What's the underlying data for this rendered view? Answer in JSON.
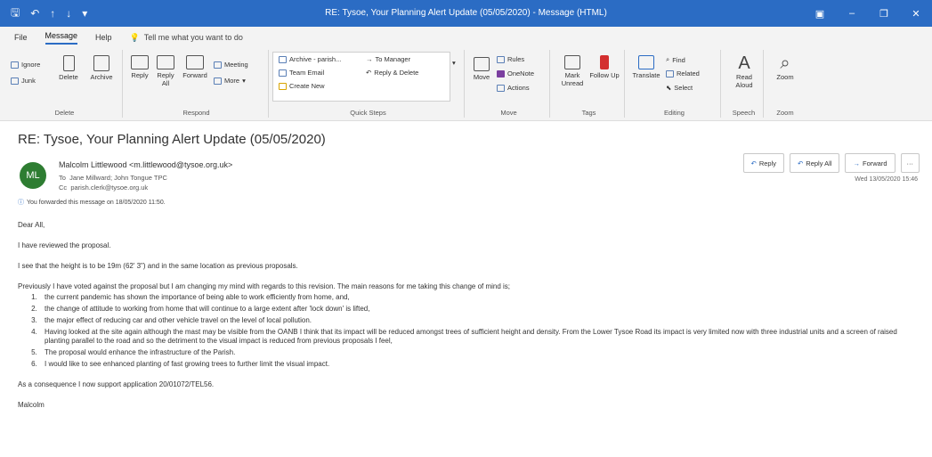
{
  "window": {
    "title": "RE: Tysoe, Your Planning Alert Update (05/05/2020) - Message (HTML)",
    "controls": {
      "ribbon_display": "▣",
      "minimize": "–",
      "maximize": "❐",
      "close": "✕"
    }
  },
  "quick_access": {
    "save_icon": "save-icon",
    "undo_icon": "undo-icon",
    "up_icon": "up-arrow-icon",
    "down_icon": "down-arrow-icon",
    "more_icon": "customize-icon"
  },
  "tabs": [
    "File",
    "Message",
    "Help"
  ],
  "active_tab": "Message",
  "tell_me": "Tell me what you want to do",
  "ribbon": {
    "delete_group": {
      "label": "Delete",
      "ignore": "Ignore",
      "junk": "Junk",
      "delete": "Delete",
      "archive": "Archive"
    },
    "respond_group": {
      "label": "Respond",
      "reply": "Reply",
      "reply_all": "Reply All",
      "forward": "Forward",
      "meeting": "Meeting",
      "more": "More"
    },
    "quick_steps": {
      "label": "Quick Steps",
      "items": [
        "Archive - parish...",
        "Team Email",
        "Create New",
        "To Manager",
        "Reply & Delete"
      ]
    },
    "move_group": {
      "label": "Move",
      "move": "Move",
      "rules": "Rules",
      "onenote": "OneNote",
      "actions": "Actions"
    },
    "tags_group": {
      "label": "Tags",
      "mark_unread": "Mark Unread",
      "follow_up": "Follow Up"
    },
    "editing_group": {
      "label": "Editing",
      "translate": "Translate",
      "find": "Find",
      "related": "Related",
      "select": "Select"
    },
    "speech_group": {
      "label": "Speech",
      "read_aloud": "Read Aloud"
    },
    "zoom_group": {
      "label": "Zoom",
      "zoom": "Zoom"
    }
  },
  "message": {
    "subject": "RE: Tysoe, Your Planning Alert Update (05/05/2020)",
    "avatar_initials": "ML",
    "avatar_color": "#2e7d32",
    "from": "Malcolm Littlewood <m.littlewood@tysoe.org.uk>",
    "to_label": "To",
    "to": "Jane Millward; John Tongue TPC",
    "cc_label": "Cc",
    "cc": "parish.clerk@tysoe.org.uk",
    "forwarded_note": "You forwarded this message on 18/05/2020 11:50.",
    "date": "Wed 13/05/2020 15:46",
    "actions": {
      "reply": "Reply",
      "reply_all": "Reply All",
      "forward": "Forward",
      "more": "···"
    },
    "greeting": "Dear All,",
    "p1": "I have reviewed the proposal.",
    "p2": "I see that the height is to be 19m (62' 3\") and in the same location as previous proposals.",
    "p3": "Previously I have voted against the proposal but I am changing my mind with regards to this revision.  The main reasons for me taking this change of mind is;",
    "reasons": [
      "the current pandemic has shown the importance of being able to work efficiently from home, and,",
      "the change of attitude to working from home that will continue to a large extent after 'lock down' is lifted,",
      "the major effect of reducing car and other vehicle travel on the level of local pollution.",
      "Having looked at the site again although the mast may be visible from the OANB I think that its impact will be reduced amongst trees of sufficient height and density.  From the Lower Tysoe Road its impact is very limited now with three industrial units and a screen of raised planting parallel to the road and so the detriment to the visual impact is reduced from previous proposals I feel,",
      "The proposal would enhance the infrastructure of the Parish.",
      "I would like to see enhanced planting of fast growing trees to further limit the visual impact."
    ],
    "conclusion": "As a consequence I now support application 20/01072/TEL56.",
    "signature": "Malcolm"
  }
}
